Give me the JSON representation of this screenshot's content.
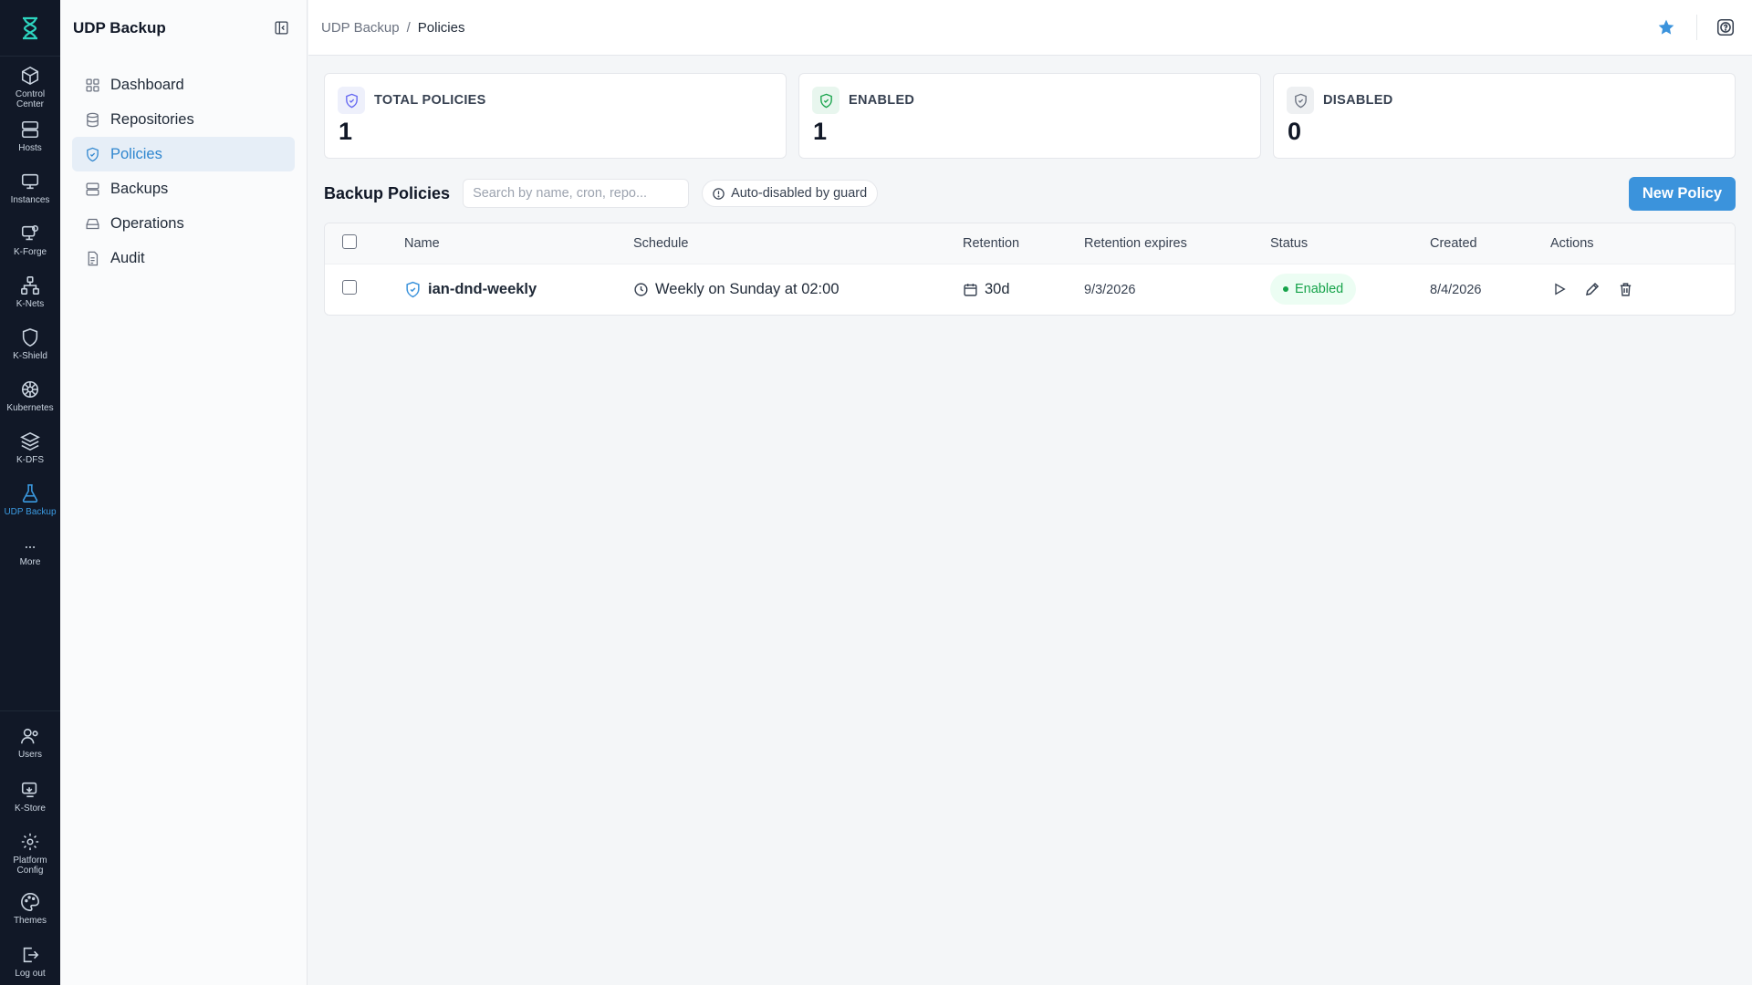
{
  "rail": {
    "top": [
      {
        "label": "Control Center",
        "icon": "cube-icon",
        "active": false
      },
      {
        "label": "Hosts",
        "icon": "server-icon",
        "active": false
      },
      {
        "label": "Instances",
        "icon": "monitor-icon",
        "active": false
      },
      {
        "label": "K-Forge",
        "icon": "monitor-gear-icon",
        "active": false
      },
      {
        "label": "K-Nets",
        "icon": "network-icon",
        "active": false
      },
      {
        "label": "K-Shield",
        "icon": "shield-icon",
        "active": false
      },
      {
        "label": "Kubernetes",
        "icon": "helm-icon",
        "active": false
      },
      {
        "label": "K-DFS",
        "icon": "layers-icon",
        "active": false
      },
      {
        "label": "UDP Backup",
        "icon": "flask-icon",
        "active": true
      },
      {
        "label": "More",
        "icon": "more-icon",
        "active": false
      }
    ],
    "bottom": [
      {
        "label": "Users",
        "icon": "users-icon"
      },
      {
        "label": "K-Store",
        "icon": "store-icon"
      },
      {
        "label": "Platform Config",
        "icon": "gear-icon"
      },
      {
        "label": "Themes",
        "icon": "palette-icon"
      },
      {
        "label": "Log out",
        "icon": "logout-icon"
      }
    ]
  },
  "sidebar": {
    "title": "UDP Backup",
    "items": [
      {
        "label": "Dashboard",
        "icon": "grid-icon",
        "active": false
      },
      {
        "label": "Repositories",
        "icon": "database-icon",
        "active": false
      },
      {
        "label": "Policies",
        "icon": "shield-check-icon",
        "active": true
      },
      {
        "label": "Backups",
        "icon": "server-icon",
        "active": false
      },
      {
        "label": "Operations",
        "icon": "drive-icon",
        "active": false
      },
      {
        "label": "Audit",
        "icon": "document-icon",
        "active": false
      }
    ]
  },
  "breadcrumb": {
    "parent": "UDP Backup",
    "separator": "/",
    "current": "Policies"
  },
  "stats": [
    {
      "label": "TOTAL POLICIES",
      "value": "1",
      "color": "#6366f1",
      "bg": "#eef0fb"
    },
    {
      "label": "ENABLED",
      "value": "1",
      "color": "#16a34a",
      "bg": "#e8f6ee"
    },
    {
      "label": "DISABLED",
      "value": "0",
      "color": "#6b7280",
      "bg": "#eef0f2"
    }
  ],
  "toolbar": {
    "title": "Backup Policies",
    "search_placeholder": "Search by name, cron, repo...",
    "guard_chip": "Auto-disabled by guard",
    "new_button": "New Policy"
  },
  "table": {
    "headers": [
      "Name",
      "Schedule",
      "Retention",
      "Retention expires",
      "Status",
      "Created",
      "Actions"
    ],
    "rows": [
      {
        "name": "ian-dnd-weekly",
        "schedule": "Weekly on Sunday at 02:00",
        "retention": "30d",
        "expires": "9/3/2026",
        "status": "Enabled",
        "created": "8/4/2026"
      }
    ]
  },
  "colors": {
    "accent": "#3b93dc",
    "rail_bg": "#111827",
    "active_nav_bg": "#e6eef7"
  }
}
